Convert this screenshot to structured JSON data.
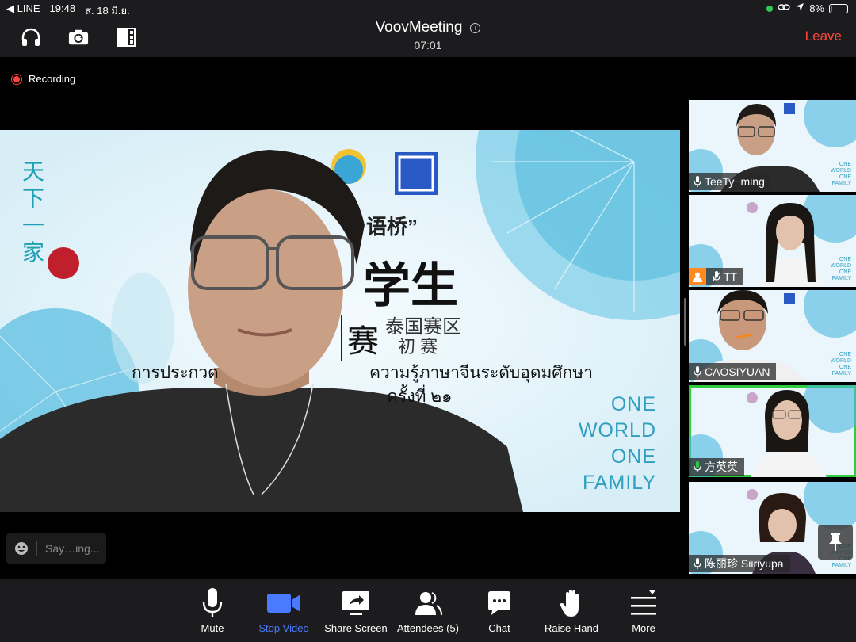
{
  "status": {
    "carrier": "◀ LINE",
    "time": "19:48",
    "date": "ส. 18 มิ.ย.",
    "battery": "8%",
    "battery_level": 0.08
  },
  "header": {
    "title": "VoovMeeting",
    "title_display": "VoovMeeting",
    "elapsed": "07:01",
    "leave_label": "Leave"
  },
  "recording_label": "Recording",
  "main_video": {
    "overlay": {
      "left_vertical": "天下一家",
      "bridge_quote": "语桥”",
      "students": "学生",
      "sai": "赛",
      "region": "泰国赛区",
      "prelim": "初 赛",
      "thai_line_left": "การประกวด",
      "thai_line_right": "ความรู้ภาษาจีนระดับอุดมศึกษา",
      "thai_line2": "ครั้งที่ ๒๑",
      "one_world": [
        "ONE",
        "WORLD",
        "ONE",
        "FAMILY"
      ]
    }
  },
  "participants": [
    {
      "name": "TeeTy−ming",
      "active": false
    },
    {
      "name": "TT",
      "active": false
    },
    {
      "name": "CAOSIYUAN",
      "active": false
    },
    {
      "name": "方英英",
      "active": true
    },
    {
      "name": "陈丽珍 Siiriyupa",
      "active": false
    }
  ],
  "chat_input": {
    "placeholder": "Say…ing..."
  },
  "toolbar": {
    "mute": "Mute",
    "stop_video": "Stop Video",
    "share_screen": "Share Screen",
    "attendees": "Attendees (5)",
    "chat": "Chat",
    "raise_hand": "Raise Hand",
    "more": "More"
  },
  "colors": {
    "accent": "#4a7bff",
    "leave": "#ff453a",
    "active_border": "#2ecc40",
    "recording": "#ff453a"
  }
}
